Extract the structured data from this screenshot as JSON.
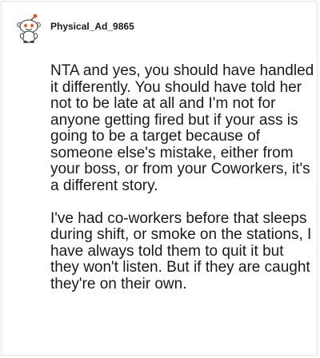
{
  "comment": {
    "username": "Physical_Ad_9865",
    "avatar_icon": "snoo-avatar-icon",
    "paragraphs": [
      "NTA and yes, you should have handled it differently. You should have told her not to be late at all and I'm not for anyone getting fired but if your ass is going to be a target because of someone else's mistake, either from your boss, or from your Coworkers, it's a different story.",
      "I've had co-workers before that sleeps during shift, or smoke on the stations, I have always told them to quit it but they won't listen. But if they are caught they're on their own."
    ]
  },
  "colors": {
    "text": "#1a1a1b",
    "border": "#e3e3e3",
    "avatar_accent": "#ff4500"
  }
}
